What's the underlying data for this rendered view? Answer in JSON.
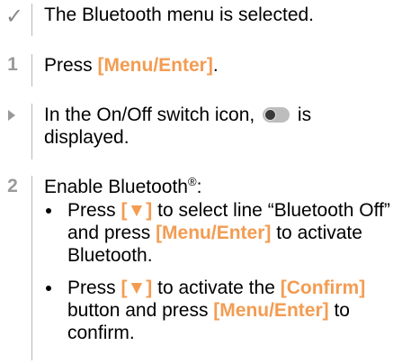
{
  "step_result": {
    "marker": "✓",
    "text": "The Bluetooth menu is selected."
  },
  "step1": {
    "number": "1",
    "prefix": "Press ",
    "key": "[Menu/Enter]",
    "suffix": "."
  },
  "result2": {
    "text_before_icon": "In the On/Off switch icon, ",
    "icon": "toggle-off-icon",
    "text_after_icon": " is displayed."
  },
  "step2": {
    "number": "2",
    "text": "Enable Bluetooth",
    "sup": "®",
    "colon": ":",
    "bullets": [
      {
        "p1": "Press ",
        "key1": "[▼]",
        "p2": " to select line “Bluetooth Off” and press ",
        "key2": "[Menu/Enter]",
        "p3": " to activate Bluetooth."
      },
      {
        "p1": "Press ",
        "key1": "[▼]",
        "p2": " to activate the ",
        "key2": "[Confirm]",
        "p3": " button and press ",
        "key3": "[Menu/Enter]",
        "p4": " to confirm."
      }
    ]
  },
  "colors": {
    "key_highlight": "#f39c52",
    "marker_gray": "#9a9a9a",
    "divider": "#b8b8b8"
  }
}
